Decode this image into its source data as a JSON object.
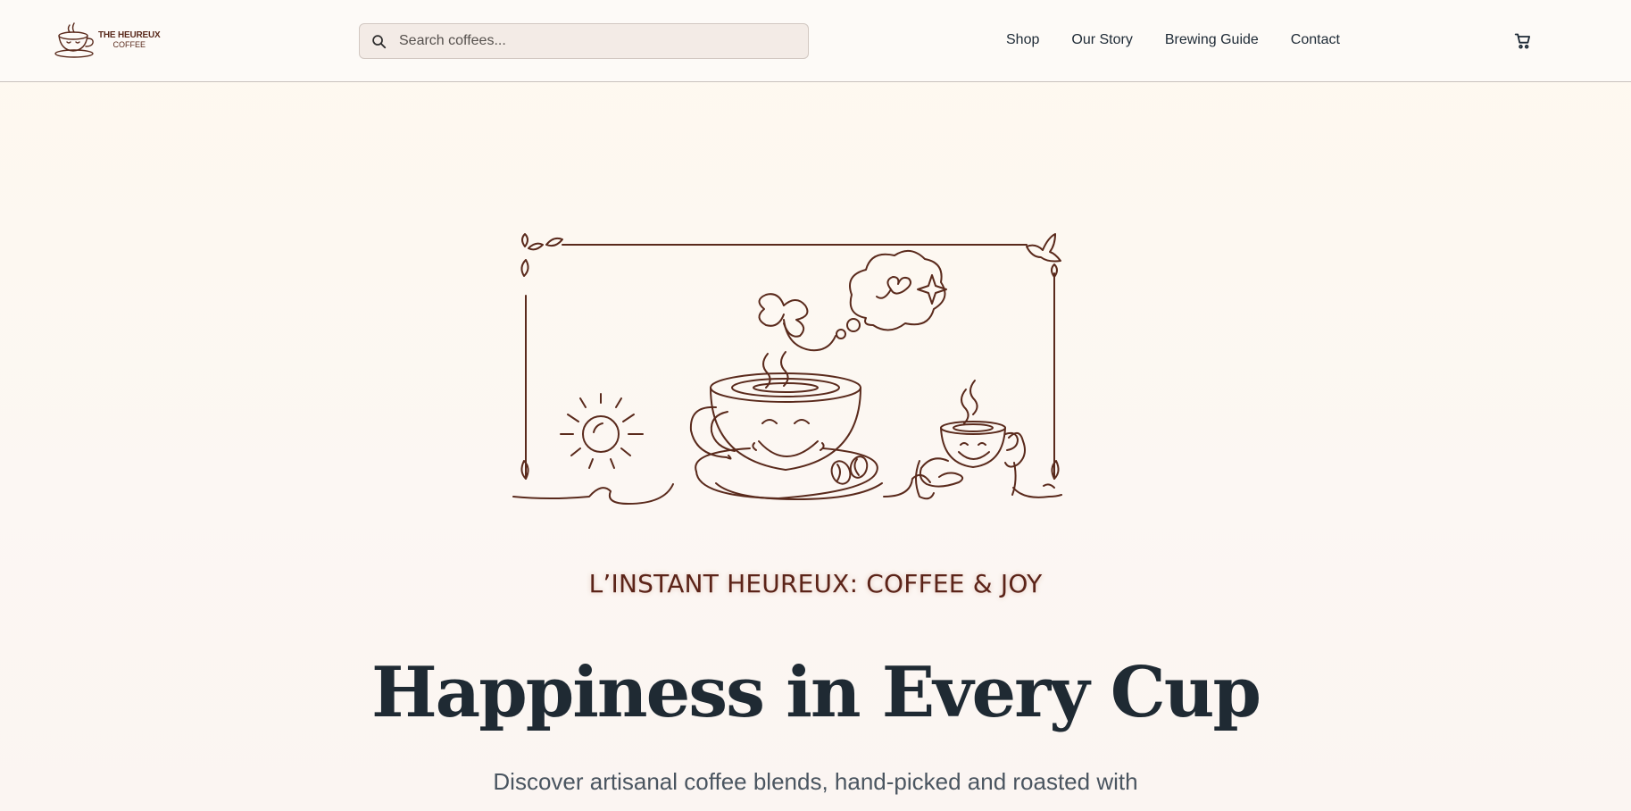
{
  "header": {
    "logo": {
      "line1": "THE HEUREUX",
      "line2": "COFFEE"
    },
    "search": {
      "placeholder": "Search coffees...",
      "value": ""
    },
    "nav": [
      "Shop",
      "Our Story",
      "Brewing Guide",
      "Contact"
    ],
    "cart_icon": "cart-icon"
  },
  "hero": {
    "illustration": "coffee-cup-line-art",
    "tagline": "L’INSTANT HEUREUX: COFFEE & JOY",
    "headline": "Happiness in Every Cup",
    "subtext": "Discover artisanal coffee blends, hand-picked and roasted with"
  },
  "colors": {
    "brand_brown": "#5b2318",
    "line_art": "#5a2a1c",
    "heading": "#1f2a33",
    "background": "#fcf7f3"
  }
}
